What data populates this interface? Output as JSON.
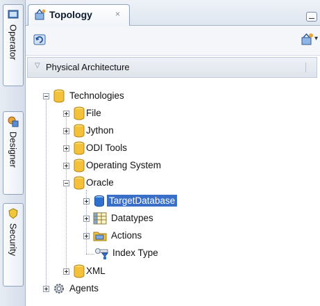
{
  "side_tabs": [
    {
      "label": "Operator",
      "icon": "operator-icon"
    },
    {
      "label": "Designer",
      "icon": "designer-icon"
    },
    {
      "label": "Security",
      "icon": "security-icon"
    }
  ],
  "tab": {
    "title": "Topology",
    "close": "×",
    "icon": "topology-icon"
  },
  "toolbar": {
    "refresh_icon": "refresh-icon",
    "new_icon": "new-topology-icon",
    "menu_caret": "▾"
  },
  "section": {
    "arrow": "▽",
    "label": "Physical Architecture"
  },
  "tree": {
    "root": "Technologies",
    "technologies": [
      "File",
      "Jython",
      "ODI Tools",
      "Operating System",
      "Oracle"
    ],
    "oracle_children": [
      "TargetDatabase",
      "Datatypes",
      "Actions",
      "Index Type"
    ],
    "after_oracle": "XML",
    "agents": "Agents",
    "selected": "TargetDatabase"
  },
  "colors": {
    "folder": "#f3c23a",
    "selection": "#3a6fc8",
    "db": "#2f6fd0"
  }
}
